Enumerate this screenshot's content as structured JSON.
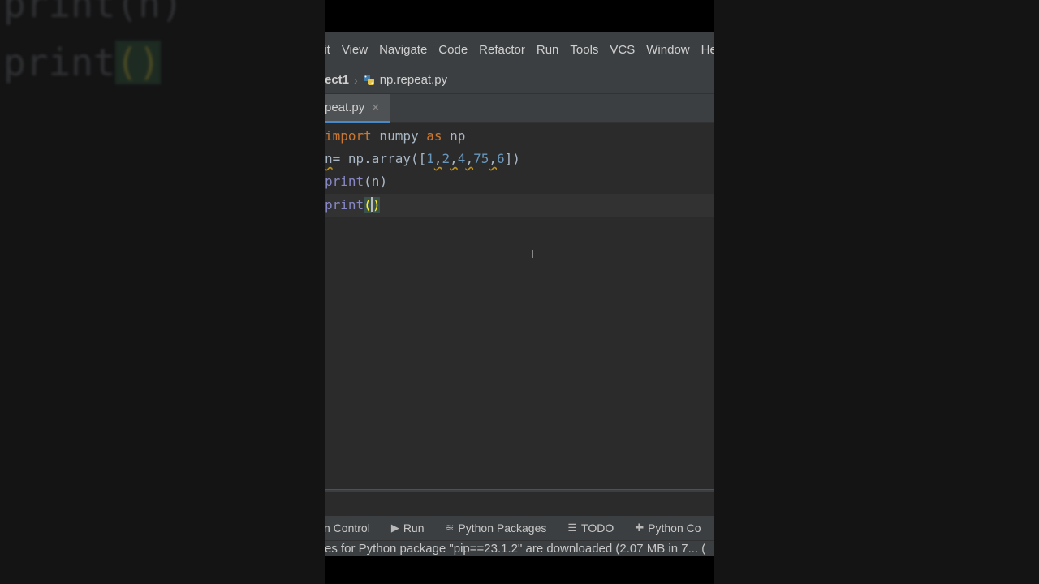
{
  "background": {
    "blurred_line_1": "print(n)",
    "blurred_line_2_prefix": "print",
    "blurred_line_2_paren": "()"
  },
  "menu": [
    "lit",
    "View",
    "Navigate",
    "Code",
    "Refactor",
    "Run",
    "Tools",
    "VCS",
    "Window",
    "Hel"
  ],
  "breadcrumb": {
    "project": "ect1",
    "file": "np.repeat.py"
  },
  "tab": {
    "label": "peat.py",
    "close_glyph": "✕"
  },
  "code": {
    "line1": {
      "kw1": "import",
      "mod": " numpy ",
      "kw2": "as",
      "alias": " np"
    },
    "line2": {
      "var": "n",
      "rest": "= np.array([",
      "n1": "1",
      "c1": ",",
      "n2": "2",
      "c2": ",",
      "n3": "4",
      "c3": ",",
      "n4": "75",
      "c4": ",",
      "n5": "6",
      "end": "])"
    },
    "line3": {
      "fn": "print",
      "args": "(n)"
    },
    "line4": {
      "fn": "print",
      "open": "(",
      "close": ")"
    }
  },
  "bottom_tools": [
    {
      "icon": "",
      "label": "n Control"
    },
    {
      "icon": "▶",
      "label": "Run"
    },
    {
      "icon": "≋",
      "label": "Python Packages"
    },
    {
      "icon": "☰",
      "label": "TODO"
    },
    {
      "icon": "✚",
      "label": "Python Co"
    }
  ],
  "status_text": "es for Python package \"pip==23.1.2\" are downloaded (2.07 MB in 7... (",
  "colors": {
    "keyword": "#cc7832",
    "number": "#6897bb",
    "builtin": "#8888c6",
    "tab_underline": "#4a88c7"
  }
}
